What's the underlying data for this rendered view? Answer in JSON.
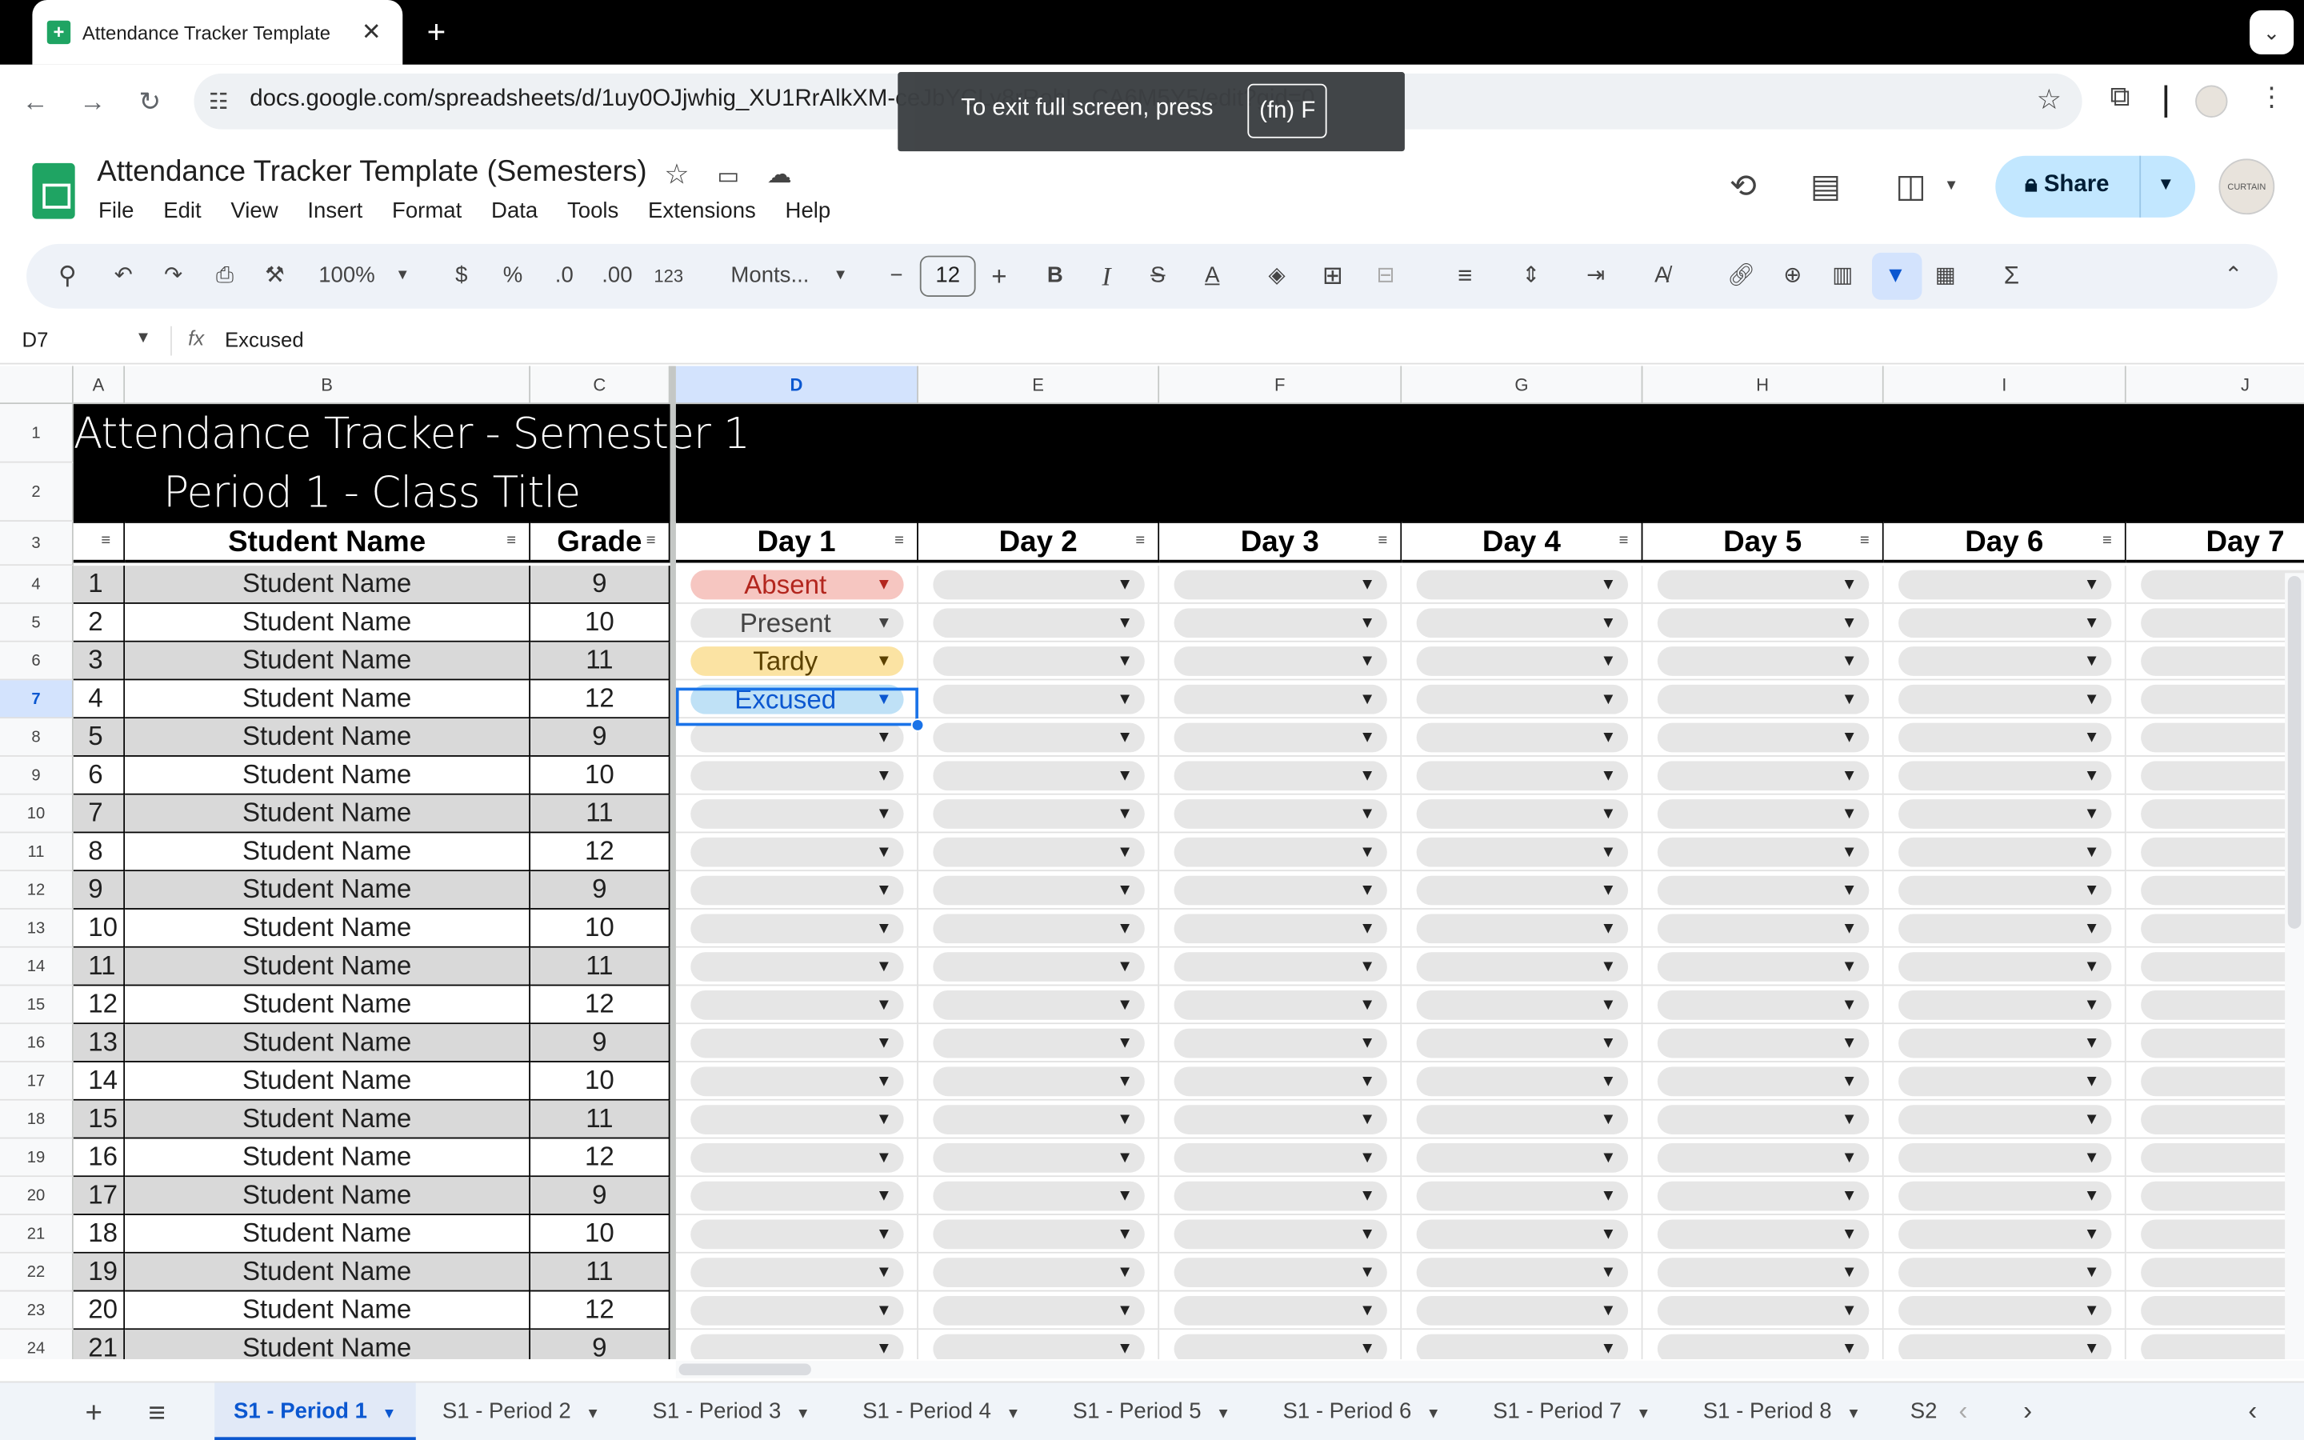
{
  "browser": {
    "tab_title": "Attendance Tracker Template",
    "url": "docs.google.com/spreadsheets/d/1uy0OJjwhig_XU1RrAlkXM-ceJbYCLy8rRobL_CA6M5Y5/edit?gid=0",
    "fullscreen_notice": "To exit full screen, press",
    "fullscreen_key": "(fn) F"
  },
  "doc": {
    "title": "Attendance Tracker Template (Semesters)",
    "menu": [
      "File",
      "Edit",
      "View",
      "Insert",
      "Format",
      "Data",
      "Tools",
      "Extensions",
      "Help"
    ],
    "share_label": "Share",
    "avatar_text": "CURTAIN"
  },
  "toolbar": {
    "zoom": "100%",
    "currency": "$",
    "percent": "%",
    "dec_dec": ".0",
    "dec_inc": ".00",
    "numfmt": "123",
    "font": "Monts...",
    "font_size": "12"
  },
  "formula_bar": {
    "cell_ref": "D7",
    "fx": "fx",
    "value": "Excused"
  },
  "grid": {
    "col_letters": [
      "A",
      "B",
      "C",
      "D",
      "E",
      "F",
      "G",
      "H",
      "I",
      "J"
    ],
    "row_numbers": [
      "1",
      "2",
      "3",
      "4",
      "5",
      "6",
      "7",
      "8",
      "9",
      "10",
      "11",
      "12",
      "13",
      "14",
      "15",
      "16",
      "17",
      "18",
      "19",
      "20",
      "21",
      "22",
      "23",
      "24"
    ],
    "title_line1": "Attendance Tracker - Semester 1",
    "title_line2": "Period 1 - Class Title",
    "headers": [
      "",
      "Student Name",
      "Grade",
      "Day 1",
      "Day 2",
      "Day 3",
      "Day 4",
      "Day 5",
      "Day 6",
      "Day 7"
    ],
    "students": [
      {
        "n": "1",
        "name": "Student Name",
        "grade": "9",
        "day1": "Absent"
      },
      {
        "n": "2",
        "name": "Student Name",
        "grade": "10",
        "day1": "Present"
      },
      {
        "n": "3",
        "name": "Student Name",
        "grade": "11",
        "day1": "Tardy"
      },
      {
        "n": "4",
        "name": "Student Name",
        "grade": "12",
        "day1": "Excused"
      },
      {
        "n": "5",
        "name": "Student Name",
        "grade": "9",
        "day1": ""
      },
      {
        "n": "6",
        "name": "Student Name",
        "grade": "10",
        "day1": ""
      },
      {
        "n": "7",
        "name": "Student Name",
        "grade": "11",
        "day1": ""
      },
      {
        "n": "8",
        "name": "Student Name",
        "grade": "12",
        "day1": ""
      },
      {
        "n": "9",
        "name": "Student Name",
        "grade": "9",
        "day1": ""
      },
      {
        "n": "10",
        "name": "Student Name",
        "grade": "10",
        "day1": ""
      },
      {
        "n": "11",
        "name": "Student Name",
        "grade": "11",
        "day1": ""
      },
      {
        "n": "12",
        "name": "Student Name",
        "grade": "12",
        "day1": ""
      },
      {
        "n": "13",
        "name": "Student Name",
        "grade": "9",
        "day1": ""
      },
      {
        "n": "14",
        "name": "Student Name",
        "grade": "10",
        "day1": ""
      },
      {
        "n": "15",
        "name": "Student Name",
        "grade": "11",
        "day1": ""
      },
      {
        "n": "16",
        "name": "Student Name",
        "grade": "12",
        "day1": ""
      },
      {
        "n": "17",
        "name": "Student Name",
        "grade": "9",
        "day1": ""
      },
      {
        "n": "18",
        "name": "Student Name",
        "grade": "10",
        "day1": ""
      },
      {
        "n": "19",
        "name": "Student Name",
        "grade": "11",
        "day1": ""
      },
      {
        "n": "20",
        "name": "Student Name",
        "grade": "12",
        "day1": ""
      },
      {
        "n": "21",
        "name": "Student Name",
        "grade": "9",
        "day1": ""
      }
    ],
    "status_colors": {
      "Absent": "#f6c6c1",
      "Present": "#e6e6e6",
      "Tardy": "#fbe3a3",
      "Excused": "#bfe1f6"
    },
    "status_text_colors": {
      "Absent": "#b3261e",
      "Present": "#444444",
      "Tardy": "#5b4100",
      "Excused": "#0b57d0"
    },
    "odd_row_bg": "#d9d9d9",
    "even_row_bg": "#ffffff"
  },
  "sheets": [
    "S1 - Period 1",
    "S1 - Period 2",
    "S1 - Period 3",
    "S1 - Period 4",
    "S1 - Period 5",
    "S1 - Period 6",
    "S1 - Period 7",
    "S1 - Period 8",
    "S2"
  ],
  "active_sheet": "S1 - Period 1"
}
